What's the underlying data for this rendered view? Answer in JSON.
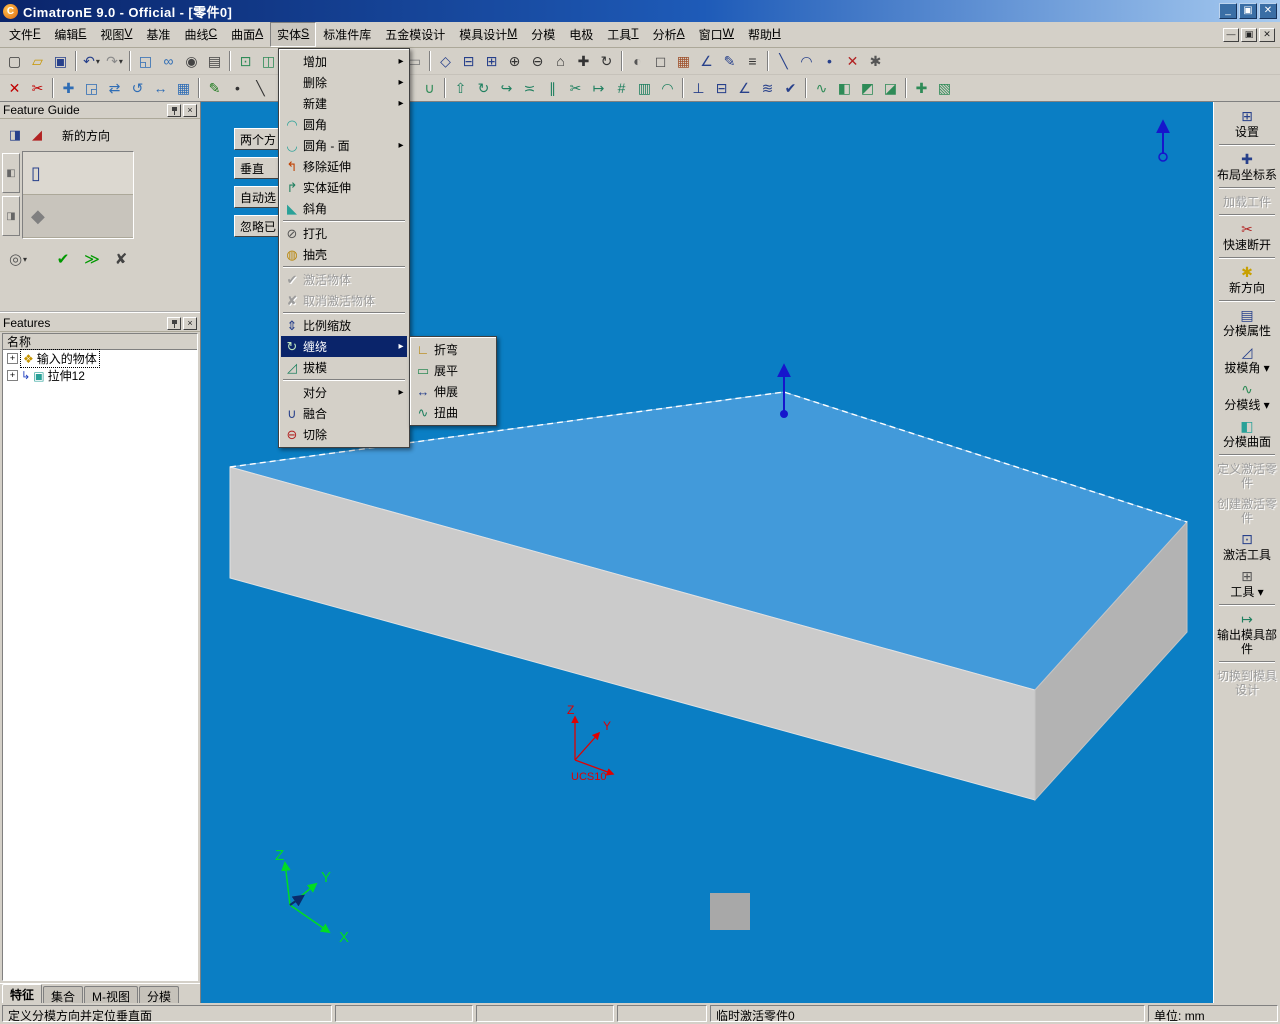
{
  "window": {
    "title": "CimatronE 9.0 - Official - [零件0]",
    "icon_letter": "C",
    "controls": {
      "minimize": "_",
      "restore": "▣",
      "close": "✕"
    },
    "mdi_controls": {
      "minimize": "—",
      "restore": "▣",
      "close": "✕"
    }
  },
  "panels": {
    "close_glyph": "×"
  },
  "menu_bar": {
    "items": [
      {
        "label": "文件",
        "mn": "F"
      },
      {
        "label": "编辑",
        "mn": "E"
      },
      {
        "label": "视图",
        "mn": "V"
      },
      {
        "label": "基准"
      },
      {
        "label": "曲线",
        "mn": "C"
      },
      {
        "label": "曲面",
        "mn": "A"
      },
      {
        "label": "实体",
        "mn": "S",
        "open": true
      },
      {
        "label": "标准件库"
      },
      {
        "label": "五金模设计"
      },
      {
        "label": "模具设计",
        "mn": "M"
      },
      {
        "label": "分模"
      },
      {
        "label": "电极"
      },
      {
        "label": "工具",
        "mn": "T"
      },
      {
        "label": "分析",
        "mn": "A"
      },
      {
        "label": "窗口",
        "mn": "W"
      },
      {
        "label": "帮助",
        "mn": "H"
      }
    ]
  },
  "toolbar_row1": [
    {
      "n": "new-file-icon",
      "g": "▢",
      "c": "#3a3a3a"
    },
    {
      "n": "open-icon",
      "g": "▱",
      "c": "#c79600"
    },
    {
      "n": "save-icon",
      "g": "▣",
      "c": "#27408b"
    },
    {
      "sep": true
    },
    {
      "n": "undo-icon",
      "g": "↶",
      "c": "#27408b",
      "d": true
    },
    {
      "n": "redo-icon",
      "g": "↷",
      "c": "#8a8a8a",
      "d": true
    },
    {
      "sep": true
    },
    {
      "n": "copy-image-icon",
      "g": "◱",
      "c": "#2f6db5"
    },
    {
      "n": "link-icon",
      "g": "∞",
      "c": "#2f6db5"
    },
    {
      "n": "snapshot-icon",
      "g": "◉",
      "c": "#444444"
    },
    {
      "n": "report-icon",
      "g": "▤",
      "c": "#444444"
    },
    {
      "sep": true
    },
    {
      "n": "filter-vertex-icon",
      "g": "⊡",
      "c": "#2e8b57"
    },
    {
      "n": "filter-edge-icon",
      "g": "◫",
      "c": "#2e8b57"
    },
    {
      "n": "filter-face-icon",
      "g": "◧",
      "c": "#2e8b57"
    },
    {
      "n": "filter-body-icon",
      "g": "◩",
      "c": "#2e8b57"
    },
    {
      "n": "filter-all-icon",
      "g": "▦",
      "c": "#2e8b57"
    },
    {
      "sep": true
    },
    {
      "n": "hide-icon",
      "g": "◌",
      "c": "#1f7a4d"
    },
    {
      "n": "show-icon",
      "g": "◍",
      "c": "#1f7a4d"
    },
    {
      "n": "blank-icon",
      "g": "▭",
      "c": "#777777"
    },
    {
      "sep": true
    },
    {
      "n": "view-iso-icon",
      "g": "◇",
      "c": "#27408b"
    },
    {
      "n": "view-top-icon",
      "g": "⊟",
      "c": "#27408b"
    },
    {
      "n": "view-front-icon",
      "g": "⊞",
      "c": "#27408b"
    },
    {
      "n": "zoom-in-icon",
      "g": "⊕",
      "c": "#333333"
    },
    {
      "n": "zoom-out-icon",
      "g": "⊖",
      "c": "#333333"
    },
    {
      "n": "zoom-fit-icon",
      "g": "⌂",
      "c": "#333333"
    },
    {
      "n": "pan-icon",
      "g": "✚",
      "c": "#333333"
    },
    {
      "n": "rotate-view-icon",
      "g": "↻",
      "c": "#333333"
    },
    {
      "sep": true
    },
    {
      "n": "shaded-icon",
      "g": "◐",
      "c": "#555555"
    },
    {
      "n": "wireframe-icon",
      "g": "◻",
      "c": "#555555"
    },
    {
      "n": "grid-icon",
      "g": "▦",
      "c": "#a0522d"
    },
    {
      "n": "measure-icon",
      "g": "∠",
      "c": "#27408b"
    },
    {
      "n": "annotate-icon",
      "g": "✎",
      "c": "#27408b"
    },
    {
      "n": "list-icon",
      "g": "≡",
      "c": "#333333"
    },
    {
      "sep": true
    },
    {
      "n": "line-tool-icon",
      "g": "╲",
      "c": "#27408b"
    },
    {
      "n": "arc-tool-icon",
      "g": "◠",
      "c": "#27408b"
    },
    {
      "n": "point-tool-icon",
      "g": "•",
      "c": "#27408b"
    },
    {
      "n": "erase-icon",
      "g": "✕",
      "c": "#b22222"
    },
    {
      "n": "options-icon",
      "g": "✱",
      "c": "#555555"
    }
  ],
  "toolbar_row2": [
    {
      "n": "delete-icon",
      "g": "✕",
      "c": "#c00000"
    },
    {
      "n": "trim-icon",
      "g": "✂",
      "c": "#c00000"
    },
    {
      "sep": true
    },
    {
      "n": "move-icon",
      "g": "✚",
      "c": "#2f6db5"
    },
    {
      "n": "copy-icon",
      "g": "◲",
      "c": "#2f6db5"
    },
    {
      "n": "mirror-icon",
      "g": "⇄",
      "c": "#2f6db5"
    },
    {
      "n": "rotate-icon",
      "g": "↺",
      "c": "#2f6db5"
    },
    {
      "n": "stretch-icon",
      "g": "↔",
      "c": "#2f6db5"
    },
    {
      "n": "array-icon",
      "g": "▦",
      "c": "#2f6db5"
    },
    {
      "sep": true
    },
    {
      "n": "sketch-icon",
      "g": "✎",
      "c": "#1d7a1d"
    },
    {
      "n": "point-icon",
      "g": "•",
      "c": "#333333"
    },
    {
      "n": "line-icon",
      "g": "╲",
      "c": "#333333"
    },
    {
      "n": "curve-icon",
      "g": "∿",
      "c": "#333333"
    },
    {
      "n": "circle-icon",
      "g": "○",
      "c": "#333333"
    },
    {
      "sep": true
    },
    {
      "n": "spline-icon",
      "g": "∼",
      "c": "#2e8b57"
    },
    {
      "n": "offset-curve-icon",
      "g": "≋",
      "c": "#2e8b57"
    },
    {
      "n": "project-curve-icon",
      "g": "↧",
      "c": "#2e8b57"
    },
    {
      "n": "intersect-icon",
      "g": "∩",
      "c": "#2e8b57"
    },
    {
      "n": "compose-icon",
      "g": "∪",
      "c": "#2e8b57"
    },
    {
      "sep": true
    },
    {
      "n": "extrude-icon",
      "g": "⇧",
      "c": "#208060"
    },
    {
      "n": "revolve-icon",
      "g": "↻",
      "c": "#208060"
    },
    {
      "n": "sweep-icon",
      "g": "↪",
      "c": "#208060"
    },
    {
      "n": "loft-icon",
      "g": "≍",
      "c": "#208060"
    },
    {
      "n": "offset-surface-icon",
      "g": "∥",
      "c": "#208060"
    },
    {
      "n": "trim-surface-icon",
      "g": "✂",
      "c": "#208060"
    },
    {
      "n": "extend-surface-icon",
      "g": "↦",
      "c": "#208060"
    },
    {
      "n": "stitch-icon",
      "g": "#",
      "c": "#208060"
    },
    {
      "n": "thicken-icon",
      "g": "▥",
      "c": "#208060"
    },
    {
      "n": "round-icon",
      "g": "◠",
      "c": "#208060"
    },
    {
      "sep": true
    },
    {
      "n": "normal-icon",
      "g": "⊥",
      "c": "#27408b"
    },
    {
      "n": "section-icon",
      "g": "⊟",
      "c": "#27408b"
    },
    {
      "n": "draft-check-icon",
      "g": "∠",
      "c": "#27408b"
    },
    {
      "n": "reflection-icon",
      "g": "≋",
      "c": "#27408b"
    },
    {
      "n": "check-icon",
      "g": "✔",
      "c": "#27408b"
    },
    {
      "sep": true
    },
    {
      "n": "parting-line-icon",
      "g": "∿",
      "c": "#2e8b57"
    },
    {
      "n": "parting-surface-icon",
      "g": "◧",
      "c": "#2e8b57"
    },
    {
      "n": "core-icon",
      "g": "◩",
      "c": "#2e8b57"
    },
    {
      "n": "cavity-icon",
      "g": "◪",
      "c": "#2e8b57"
    },
    {
      "sep": true
    },
    {
      "n": "ucs-icon",
      "g": "✚",
      "c": "#2e8b57"
    },
    {
      "n": "layers-icon",
      "g": "▧",
      "c": "#2e8b57"
    }
  ],
  "solid_menu": {
    "items": [
      {
        "label": "增加",
        "submenu": true
      },
      {
        "label": "删除",
        "submenu": true
      },
      {
        "label": "新建",
        "submenu": true
      },
      {
        "label": "圆角",
        "g": "◠",
        "c": "#2aa198"
      },
      {
        "label": "圆角 - 面",
        "g": "◡",
        "c": "#2aa198",
        "submenu": true
      },
      {
        "label": "移除延伸",
        "g": "↰",
        "c": "#c04000"
      },
      {
        "label": "实体延伸",
        "g": "↱",
        "c": "#208060"
      },
      {
        "label": "斜角",
        "g": "◣",
        "c": "#2aa198"
      },
      {
        "sep": true
      },
      {
        "label": "打孔",
        "g": "⊘",
        "c": "#555555"
      },
      {
        "label": "抽壳",
        "g": "◍",
        "c": "#b8860b"
      },
      {
        "sep": true
      },
      {
        "label": "激活物体",
        "g": "✔",
        "disabled": true
      },
      {
        "label": "取消激活物体",
        "g": "✘",
        "disabled": true
      },
      {
        "sep": true
      },
      {
        "label": "比例缩放",
        "g": "⇕",
        "c": "#27408b"
      },
      {
        "label": "缠绕",
        "g": "↻",
        "c": "#208060",
        "submenu": true,
        "hl": true
      },
      {
        "label": "拔模",
        "g": "◿",
        "c": "#208060"
      },
      {
        "sep": true
      },
      {
        "label": "对分",
        "submenu": true
      },
      {
        "label": "融合",
        "g": "∪",
        "c": "#27408b"
      },
      {
        "label": "切除",
        "g": "⊖",
        "c": "#b22222"
      }
    ]
  },
  "wrap_submenu": {
    "items": [
      {
        "label": "折弯",
        "g": "∟",
        "c": "#b8860b"
      },
      {
        "label": "展平",
        "g": "▭",
        "c": "#2e8b57"
      },
      {
        "label": "伸展",
        "g": "↔",
        "c": "#27408b"
      },
      {
        "label": "扭曲",
        "g": "∿",
        "c": "#208060"
      }
    ]
  },
  "feature_guide": {
    "title": "Feature Guide",
    "header_icons": [
      {
        "n": "guide-direction-icon",
        "g": "◨",
        "c": "#27408b"
      },
      {
        "n": "flip-direction-icon",
        "g": "◢",
        "c": "#b22222"
      }
    ],
    "direction_label": "新的方向",
    "side_tabs": [
      {
        "n": "stage-tab-1",
        "g": "◧"
      },
      {
        "n": "stage-tab-2",
        "g": "◨"
      }
    ],
    "slots": [
      {
        "n": "pick-slot-direction",
        "g": "▯",
        "c": "#27408b",
        "active": true
      },
      {
        "n": "pick-slot-body",
        "g": "◆",
        "c": "#808080"
      }
    ],
    "controls": [
      {
        "n": "preview-options-icon",
        "g": "◎",
        "c": "#555555",
        "d": true
      },
      {
        "n": "ok-icon",
        "g": "✔",
        "c": "#009900"
      },
      {
        "n": "next-icon",
        "g": "≫",
        "c": "#009900"
      },
      {
        "n": "cancel-icon",
        "g": "✘",
        "c": "#444444"
      }
    ]
  },
  "features_panel": {
    "title": "Features",
    "column_header": "名称",
    "items": [
      {
        "label": "输入的物体",
        "icon_glyph": "❖",
        "icon_color": "#c89600",
        "focused": true
      },
      {
        "label": "拉伸12",
        "icon_glyph": "▣",
        "icon_color": "#2aa198",
        "arrow": true
      }
    ]
  },
  "bottom_tabs": {
    "items": [
      {
        "label": "特征",
        "active": true
      },
      {
        "label": "集合"
      },
      {
        "label": "M-视图"
      },
      {
        "label": "分模"
      }
    ]
  },
  "right_toolbar": {
    "items": [
      {
        "label": "设置",
        "icon": "⊞",
        "c": "#27408b"
      },
      {
        "sep": true
      },
      {
        "label": "布局坐标系",
        "icon": "✚",
        "c": "#27408b"
      },
      {
        "sep": true
      },
      {
        "label": "加载工件",
        "disabled": true
      },
      {
        "sep": true
      },
      {
        "label": "快速断开",
        "icon": "✂",
        "c": "#b22222"
      },
      {
        "sep": true
      },
      {
        "label": "新方向",
        "icon": "✱",
        "c": "#c8a000"
      },
      {
        "sep": true
      },
      {
        "label": "分模属性",
        "icon": "▤",
        "c": "#27408b"
      },
      {
        "label": "拔模角",
        "icon": "◿",
        "c": "#27408b",
        "dropdown": true
      },
      {
        "label": "分模线",
        "icon": "∿",
        "c": "#2e8b57",
        "dropdown": true
      },
      {
        "label": "分模曲面",
        "icon": "◧",
        "c": "#2aa198"
      },
      {
        "sep": true
      },
      {
        "label": "定义激活零件",
        "disabled": true
      },
      {
        "label": "创建激活零件",
        "disabled": true
      },
      {
        "label": "激活工具",
        "icon": "⊡",
        "c": "#27408b"
      },
      {
        "label": "工具",
        "icon": "⊞",
        "c": "#555555",
        "dropdown": true
      },
      {
        "sep": true
      },
      {
        "label": "输出模具部件",
        "icon": "↦",
        "c": "#208060"
      },
      {
        "sep": true
      },
      {
        "label": "切换到模具设计",
        "disabled": true
      }
    ]
  },
  "viewport": {
    "bg": "#0a7ec4",
    "box_top": "#429ada",
    "box_left": "#cbcbcb",
    "box_right": "#b3b3b3",
    "ucs_label": "UCS10",
    "axis_x": "X",
    "axis_y": "Y",
    "axis_z": "Z",
    "float_buttons": [
      "两个方",
      "垂直",
      "自动选",
      "忽略已"
    ]
  },
  "status_bar": {
    "message": "定义分模方向并定位垂直面",
    "active_part": "临时激活零件0",
    "units_label": "单位:",
    "units_value": "mm"
  },
  "colors": {
    "titlebar_left": "#0a246a",
    "titlebar_right": "#a6caf0",
    "chrome": "#d4d0c8",
    "menu_highlight": "#0a246a",
    "viewport_bg": "#0a7ec4",
    "box_top": "#429ada",
    "selection_blue": "#1616cc",
    "ucs_red": "#e00000",
    "triad_green": "#00dd22"
  }
}
